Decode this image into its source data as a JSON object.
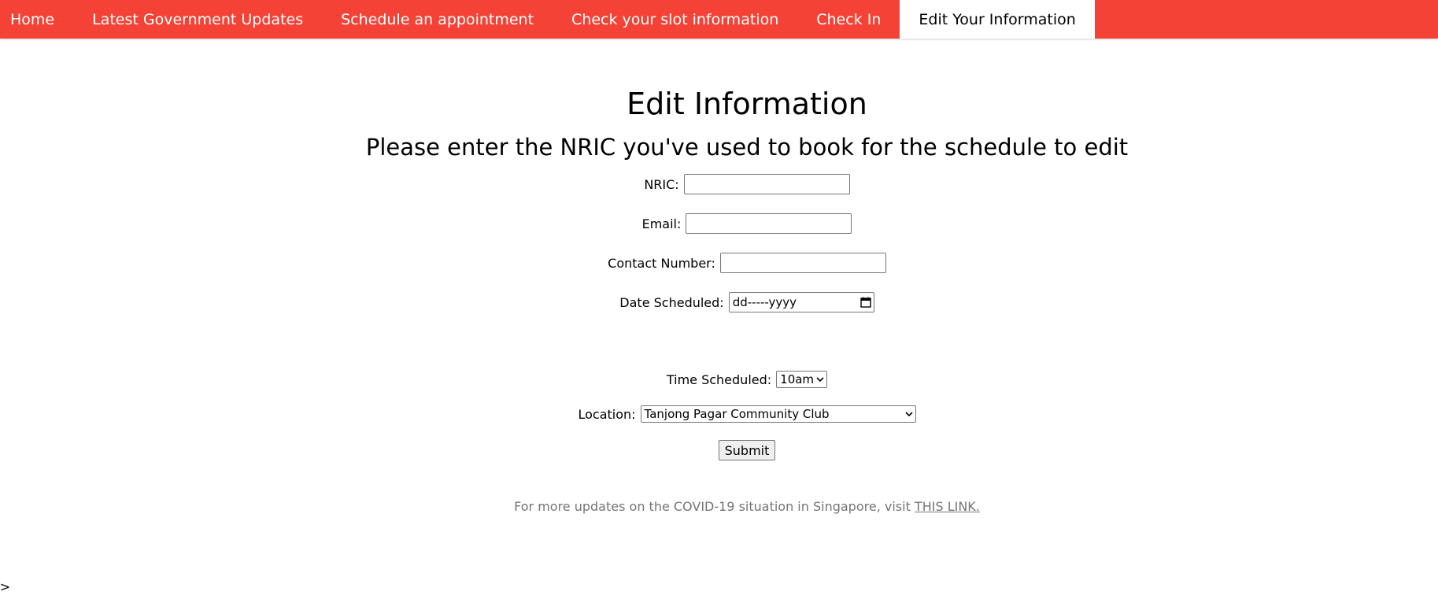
{
  "nav": {
    "items": [
      {
        "label": "Home"
      },
      {
        "label": "Latest Government Updates"
      },
      {
        "label": "Schedule an appointment"
      },
      {
        "label": "Check your slot information"
      },
      {
        "label": "Check In"
      },
      {
        "label": "Edit Your Information",
        "active": true
      }
    ],
    "bar_color": "#f44336"
  },
  "page": {
    "title": "Edit Information",
    "subtitle": "Please enter the NRIC you've used to book for the schedule to edit"
  },
  "form": {
    "nric_label": "NRIC:",
    "nric_value": "",
    "email_label": "Email:",
    "email_value": "",
    "contact_label": "Contact Number:",
    "contact_value": "",
    "date_label": "Date Scheduled:",
    "date_placeholder": "dd-----yyyy",
    "time_label": "Time Scheduled:",
    "time_selected": "10am",
    "location_label": "Location:",
    "location_selected": "Tanjong Pagar Community Club",
    "submit_label": "Submit"
  },
  "footer": {
    "text": "For more updates on the COVID-19 situation in Singapore, visit ",
    "link_text": "THIS LINK."
  },
  "stray": "->"
}
